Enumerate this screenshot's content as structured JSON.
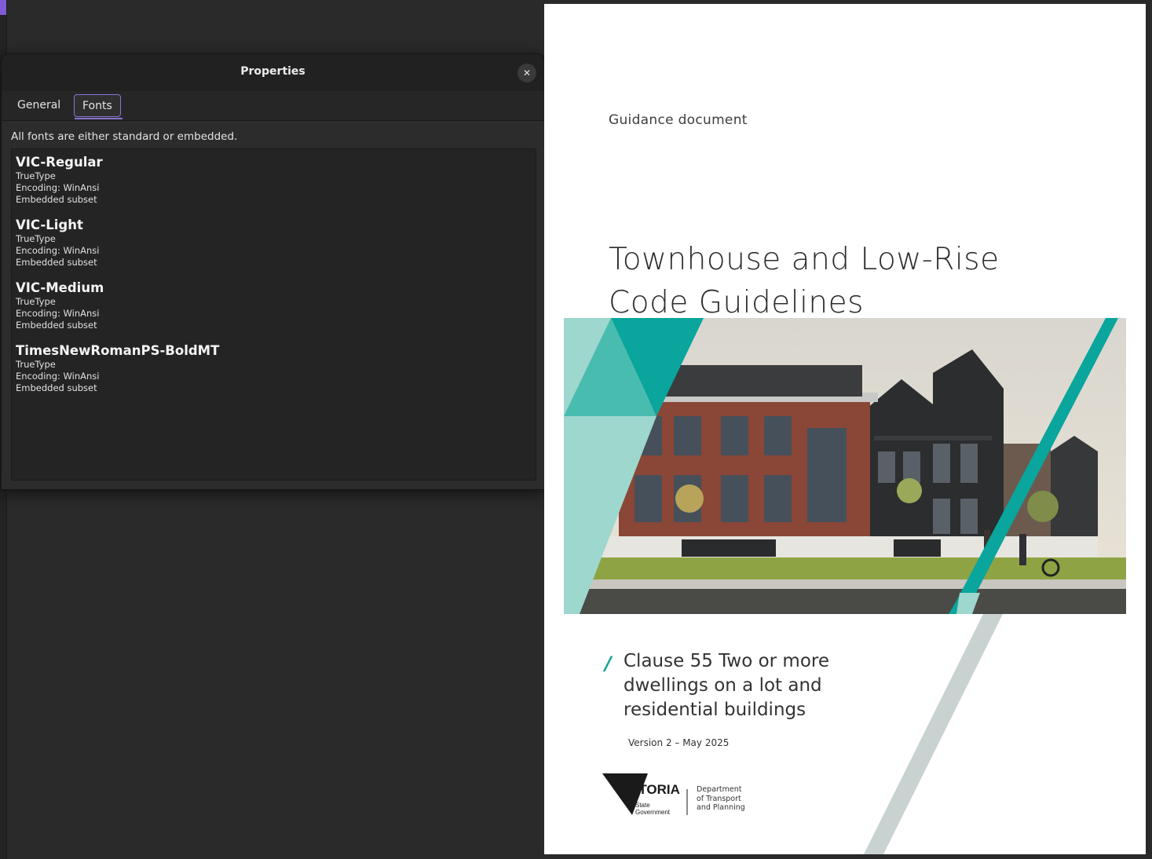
{
  "dialog": {
    "title": "Properties",
    "close_label": "✕",
    "tabs": [
      {
        "label": "General",
        "active": false
      },
      {
        "label": "Fonts",
        "active": true
      }
    ],
    "summary": "All fonts are either standard or embedded.",
    "fonts": [
      {
        "name": "VIC-Regular",
        "type": "TrueType",
        "encoding": "Encoding: WinAnsi",
        "embedding": "Embedded subset"
      },
      {
        "name": "VIC-Light",
        "type": "TrueType",
        "encoding": "Encoding: WinAnsi",
        "embedding": "Embedded subset"
      },
      {
        "name": "VIC-Medium",
        "type": "TrueType",
        "encoding": "Encoding: WinAnsi",
        "embedding": "Embedded subset"
      },
      {
        "name": "TimesNewRomanPS-BoldMT",
        "type": "TrueType",
        "encoding": "Encoding: WinAnsi",
        "embedding": "Embedded subset"
      }
    ]
  },
  "document": {
    "subtitle": "Guidance document",
    "title_lines": [
      "Townhouse and Low-Rise",
      "Code Guidelines"
    ],
    "clause_lines": [
      "Clause 55 Two or more",
      "dwellings on a lot and",
      "residential buildings"
    ],
    "version": "Version 2 – May 2025",
    "logo": {
      "wordmark": "VICTORIA",
      "sub_lines": [
        "State",
        "Government"
      ]
    },
    "department_lines": [
      "Department",
      "of Transport",
      "and Planning"
    ]
  },
  "colors": {
    "accent": "#8a74d0",
    "teal": "#0aa59c",
    "teal_light": "#9dd7cd",
    "stripe_grey": "#c9d1d1"
  }
}
